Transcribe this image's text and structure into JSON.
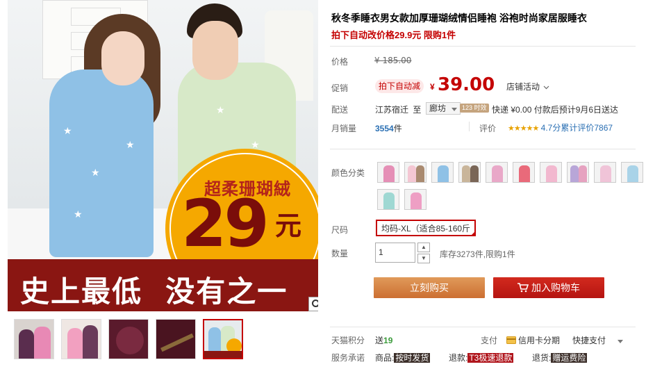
{
  "product": {
    "title": "秋冬季睡衣男女款加厚珊瑚绒情侣睡袍 浴袍时尚家居服睡衣",
    "subtitle": "拍下自动改价格29.9元 限购1件"
  },
  "image": {
    "promo_sub": "超柔珊瑚絨",
    "promo_number": "29",
    "promo_unit": "元",
    "banner_text": "史上最低  没有之一"
  },
  "price": {
    "label": "价格",
    "original": "¥ 185.00"
  },
  "promo": {
    "label": "促销",
    "tag": "拍下自动减",
    "currency": "¥",
    "amount": "39.00",
    "activity": "店铺活动"
  },
  "shipping": {
    "label": "配送",
    "from": "江苏宿迁",
    "to_word": "至",
    "city": "廊坊",
    "badge": "123 时效",
    "info": "快递 ¥0.00 付款后预计9月6日送达"
  },
  "sales": {
    "label": "月销量",
    "count": "3554",
    "unit": "件",
    "rating_label": "评价",
    "stars": "★★★★★",
    "score": "4.7分",
    "review_text": "累计评价",
    "review_count": "7867"
  },
  "color": {
    "label": "颜色分类"
  },
  "size": {
    "label": "尺码",
    "option": "均码-XL（适合85-160斤"
  },
  "quantity": {
    "label": "数量",
    "value": "1",
    "up": "▲",
    "down": "▼",
    "stock": "库存3273件,限购1件"
  },
  "buttons": {
    "buy": "立刻购买",
    "cart": "加入购物车"
  },
  "points": {
    "label": "天猫积分",
    "send": "送",
    "value": "19",
    "pay_label": "支付",
    "credit": "信用卡分期",
    "quick": "快捷支付"
  },
  "service": {
    "label": "服务承诺",
    "goods_label": "商品:",
    "goods_tag": "按时发货",
    "refund_label": "退款:",
    "refund_tag": "T3极速退款",
    "return_label": "退货:",
    "return_tag": "赠运费险"
  },
  "colors": {
    "accent": "#c40000",
    "buy_button": "#d47c3f",
    "cart_button": "#c41d16",
    "promo_circle": "#f5a800",
    "banner": "#8a1612"
  }
}
